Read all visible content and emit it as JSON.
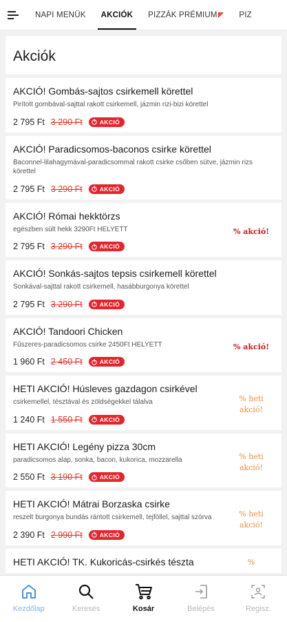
{
  "tabs": [
    {
      "label": "NAPI MENÜK",
      "active": false
    },
    {
      "label": "AKCIÓK",
      "active": true
    },
    {
      "label": "PIZZÁK PRÉMIUM",
      "active": false,
      "icon": "pizza-slice-icon"
    },
    {
      "label": "PIZ",
      "active": false
    }
  ],
  "page": {
    "title": "Akciók"
  },
  "badge_label": "AKCIÓ",
  "items": [
    {
      "title": "AKCIÓ! Gombás-sajtos csirkemell körettel",
      "desc": "Pirított gombával-sajttal rakott csirkemell, jázmin rizi-bizi körettel",
      "price": "2 795 Ft",
      "old_price": "3 290 Ft",
      "promo": ""
    },
    {
      "title": "AKCIÓ! Paradicsomos-baconos csirke körettel",
      "desc": "Baconnel-lilahagymával-paradicsommal rakott csirke csőben sütve, jázmin rizs körettel",
      "price": "2 795 Ft",
      "old_price": "3 290 Ft",
      "promo": ""
    },
    {
      "title": "AKCIÓ! Római hekktörzs",
      "desc": "egészben sült hekk 3290Ft HELYETT",
      "price": "2 795 Ft",
      "old_price": "3 290 Ft",
      "promo": "% akció!",
      "promo_style": "red"
    },
    {
      "title": "AKCIÓ! Sonkás-sajtos tepsis csirkemell körettel",
      "desc": "Sonkával-sajttal rakott csirkemell, hasábburgonya körettel",
      "price": "2 795 Ft",
      "old_price": "3 290 Ft",
      "promo": ""
    },
    {
      "title": "AKCIÓ! Tandoori Chicken",
      "desc": "Fűszeres-paradicsomos csirke 2450Ft HELYETT",
      "price": "1 960 Ft",
      "old_price": "2 450 Ft",
      "promo": "% akció!",
      "promo_style": "red"
    },
    {
      "title": "HETI AKCIÓ! Húsleves gazdagon csirkével",
      "desc": "csirkemellel, tésztával és zöldségekkel tálalva",
      "price": "1 240 Ft",
      "old_price": "1 550 Ft",
      "promo": "% heti akció!",
      "promo_style": "orange"
    },
    {
      "title": "HETI AKCIÓ! Legény pizza 30cm",
      "desc": "paradicsomos alap, sonka, bacon, kukorica, mozzarella",
      "price": "2 550 Ft",
      "old_price": "3 190 Ft",
      "promo": "% heti akció!",
      "promo_style": "orange"
    },
    {
      "title": "HETI AKCIÓ! Mátrai Borzaska csirke",
      "desc": "reszelt burgonya bundás rántott csirkemell, tejföllel, sajttal szórva",
      "price": "2 390 Ft",
      "old_price": "2 990 Ft",
      "promo": "% heti akció!",
      "promo_style": "orange"
    },
    {
      "title": "HETI AKCIÓ! TK. Kukoricás-csirkés tészta",
      "desc": "",
      "price": "",
      "old_price": "",
      "promo": "%",
      "promo_style": "orange"
    }
  ],
  "bottom_nav": [
    {
      "label": "Kezdőlap",
      "icon": "home-icon",
      "state": "active"
    },
    {
      "label": "Keresés",
      "icon": "search-icon",
      "state": "normal"
    },
    {
      "label": "Kosár",
      "icon": "cart-icon",
      "state": "bold"
    },
    {
      "label": "Belépés",
      "icon": "login-icon",
      "state": "normal"
    },
    {
      "label": "Regisz.",
      "icon": "register-icon",
      "state": "normal"
    }
  ],
  "colors": {
    "accent_red": "#e3262d",
    "promo_orange": "#ef8d3a",
    "active_nav": "#4a90d9"
  }
}
